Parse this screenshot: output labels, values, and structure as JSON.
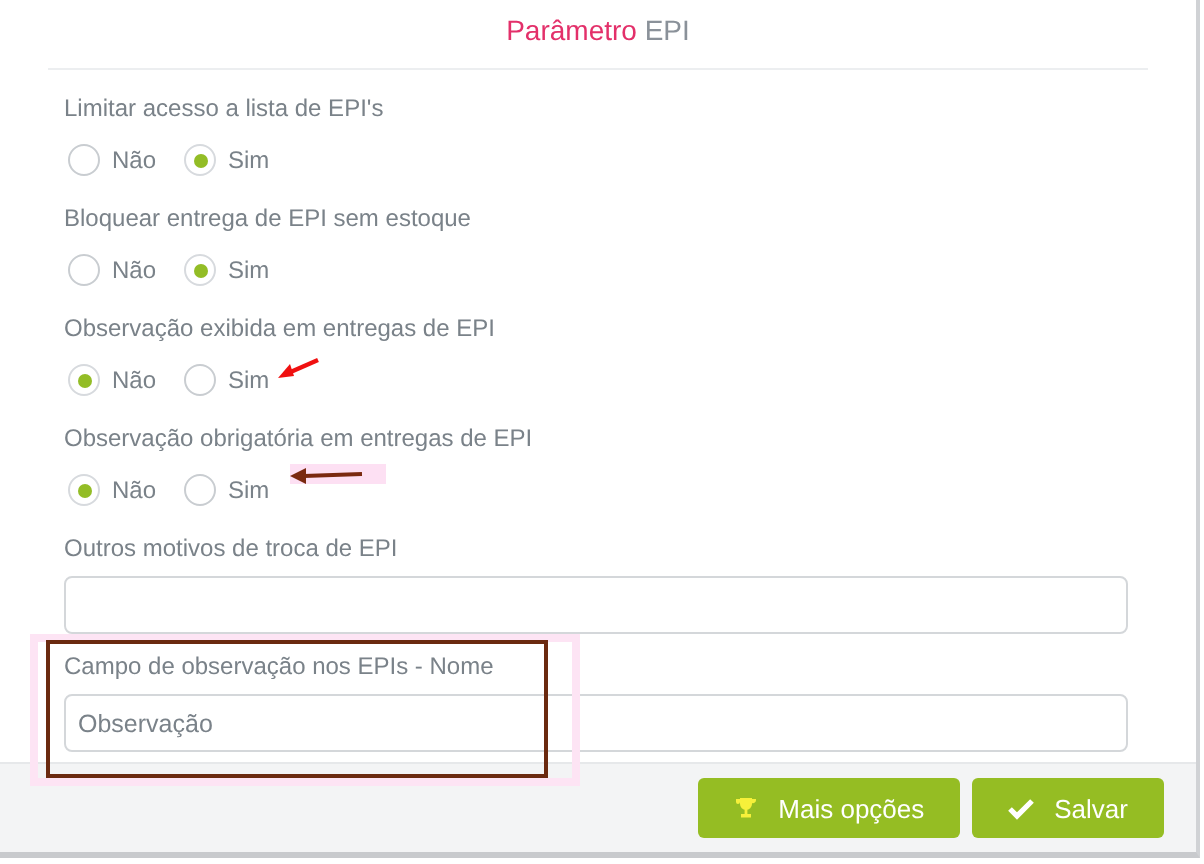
{
  "title": {
    "highlight": "Parâmetro",
    "rest": "EPI"
  },
  "options": [
    {
      "label": "Limitar acesso a lista de EPI's",
      "choices": [
        {
          "label": "Não",
          "selected": false
        },
        {
          "label": "Sim",
          "selected": true
        }
      ]
    },
    {
      "label": "Bloquear entrega de EPI sem estoque",
      "choices": [
        {
          "label": "Não",
          "selected": false
        },
        {
          "label": "Sim",
          "selected": true
        }
      ]
    },
    {
      "label": "Observação exibida em entregas de EPI",
      "choices": [
        {
          "label": "Não",
          "selected": true
        },
        {
          "label": "Sim",
          "selected": false
        }
      ]
    },
    {
      "label": "Observação obrigatória em entregas de EPI",
      "choices": [
        {
          "label": "Não",
          "selected": true
        },
        {
          "label": "Sim",
          "selected": false
        }
      ]
    }
  ],
  "fields": [
    {
      "label": "Outros motivos de troca de EPI"
    },
    {
      "label": "Campo de observação nos EPIs - Nome",
      "value": "Observação"
    }
  ],
  "buttons": [
    {
      "label": "Mais opções"
    },
    {
      "label": "Salvar"
    }
  ]
}
